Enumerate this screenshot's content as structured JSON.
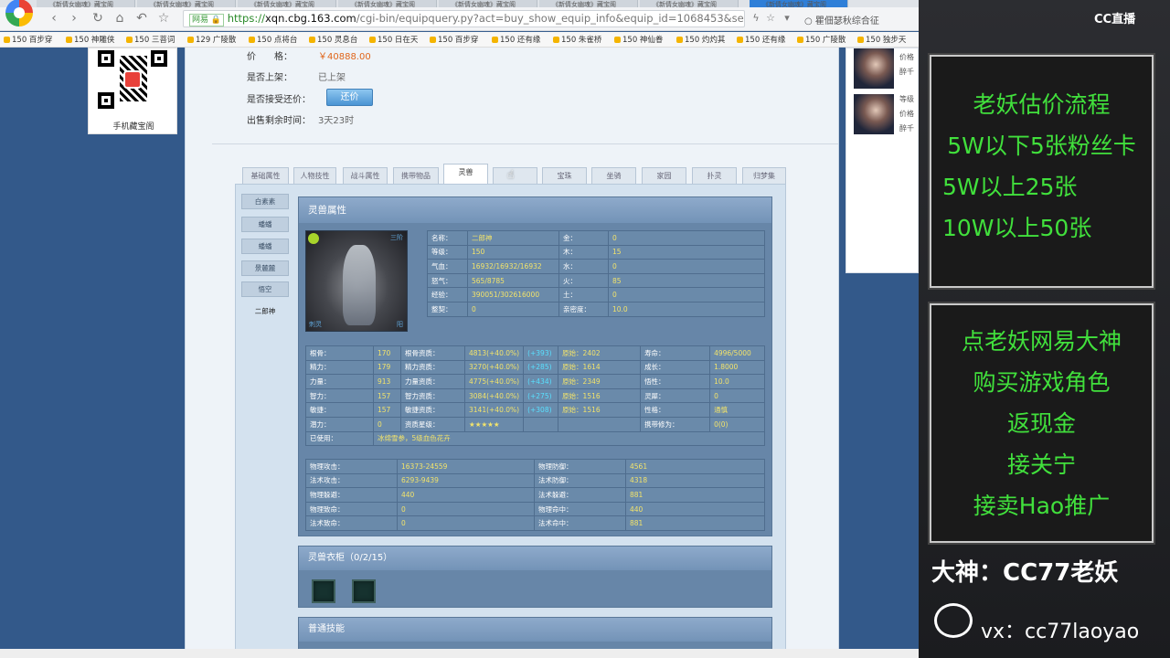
{
  "browser": {
    "tabs": [
      "《新倩女幽魂》藏宝阁",
      "《新倩女幽魂》藏宝阁",
      "《新倩女幽魂》藏宝阁",
      "《新倩女幽魂》藏宝阁",
      "《新倩女幽魂》藏宝阁",
      "《新倩女幽魂》藏宝阁",
      "《新倩女幽魂》藏宝阁",
      "《新倩女幽魂》藏宝阁"
    ],
    "nav_icons": [
      "back-icon",
      "forward-icon",
      "refresh-icon",
      "home-icon",
      "undo-icon",
      "star-icon"
    ],
    "url_badge": "网易 🔒",
    "url_scheme": "https://",
    "url_host": "xqn.cbg.163.com",
    "url_rest": "/cgi-bin/equipquery.py?act=buy_show_equip_info&equip_id=1068453&server_id",
    "search_hint": "瞿佃瑟秋综合征",
    "bookmarks": [
      "150 百步穿",
      "150 神雕侠",
      "150 三菩词",
      "129 广陵散",
      "150 点将台",
      "150 灵息台",
      "150 日在天",
      "150 百步穿",
      "150 还有缘",
      "150 朱雀桥",
      "150 神仙眷",
      "150 灼灼其",
      "150 还有缘",
      "150 广陵散",
      "150 独步天"
    ]
  },
  "qr": {
    "label": "手机藏宝阁"
  },
  "listing": {
    "price_label": "价　　格：",
    "price_value": "￥40888.00",
    "status_label": "是否上架：",
    "status_value": "已上架",
    "counter_label": "是否接受还价：",
    "counter_button": "还价",
    "time_label": "出售剩余时间：",
    "time_value": "3天23时"
  },
  "tabs": [
    "基础属性",
    "人物技性",
    "战斗属性",
    "携带物品",
    "灵兽",
    "",
    "宝珠",
    "坐骑",
    "家园",
    "扑灵",
    "归梦集"
  ],
  "active_tab": "灵兽",
  "subnav": [
    "白素素",
    "蟠蟠",
    "蟠蟠",
    "景麓麓",
    "悟空",
    "二郎神"
  ],
  "beast": {
    "title": "灵兽属性",
    "portrait_tags": {
      "top_right": "三阶",
      "bottom_left": "刺灵",
      "bottom_right": "阳"
    },
    "basic": [
      [
        "名称：",
        "二郎神",
        "金：",
        "0"
      ],
      [
        "等级：",
        "150",
        "木：",
        "15"
      ],
      [
        "气血：",
        "16932/16932/16932",
        "水：",
        "0"
      ],
      [
        "怒气：",
        "565/8785",
        "火：",
        "85"
      ],
      [
        "经验：",
        "390051/302616000",
        "土：",
        "0"
      ],
      [
        "整契：",
        "0",
        "亲密度：",
        "10.0"
      ]
    ],
    "attrs": [
      [
        "根骨：",
        "170",
        "根骨资质：",
        "4813(+40.0%)",
        "(+393)",
        "原始：2402",
        "寿命：",
        "4996/5000"
      ],
      [
        "精力：",
        "179",
        "精力资质：",
        "3270(+40.0%)",
        "(+285)",
        "原始：1614",
        "成长：",
        "1.8000"
      ],
      [
        "力量：",
        "913",
        "力量资质：",
        "4775(+40.0%)",
        "(+434)",
        "原始：2349",
        "悟性：",
        "10.0"
      ],
      [
        "智力：",
        "157",
        "智力资质：",
        "3084(+40.0%)",
        "(+275)",
        "原始：1516",
        "灵犀：",
        "0"
      ],
      [
        "敏捷：",
        "157",
        "敏捷资质：",
        "3141(+40.0%)",
        "(+308)",
        "原始：1516",
        "性格：",
        "通慎"
      ],
      [
        "潜力：",
        "0",
        "资质星级：",
        "★★★★★",
        "",
        "",
        "携带修为：",
        "0(0)"
      ]
    ],
    "used_label": "已使用：",
    "used_value": "冰绵雪参，5级血色花卉",
    "combat": [
      [
        "物理攻击：",
        "16373-24559",
        "物理防御：",
        "4561"
      ],
      [
        "法术攻击：",
        "6293-9439",
        "法术防御：",
        "4318"
      ],
      [
        "物理躲避：",
        "440",
        "法术躲避：",
        "881"
      ],
      [
        "物理致命：",
        "0",
        "物理命中：",
        "440"
      ],
      [
        "法术致命：",
        "0",
        "法术命中：",
        "881"
      ]
    ]
  },
  "wardrobe": {
    "title": "灵兽衣柜（0/2/15）"
  },
  "skills": {
    "title": "普通技能"
  },
  "sidebar": {
    "seller1": [
      "价格",
      "醉千"
    ],
    "seller2": [
      "等级",
      "价格",
      "醉千"
    ]
  },
  "overlay": {
    "platform": "CC直播",
    "box1": [
      "老妖估价流程",
      "5W以下5张粉丝卡",
      "5W以上25张",
      "10W以上50张"
    ],
    "box2": [
      "点老妖网易大神",
      "购买游戏角色",
      "返现金",
      "接关宁",
      "接卖Hao推广"
    ],
    "dashen": "大神：CC77老妖",
    "wx": "vx：cc77laoyao"
  },
  "colors": {
    "accent_green": "#41e03c",
    "price_orange": "#e0651a",
    "panel_blue": "#6786a8"
  }
}
